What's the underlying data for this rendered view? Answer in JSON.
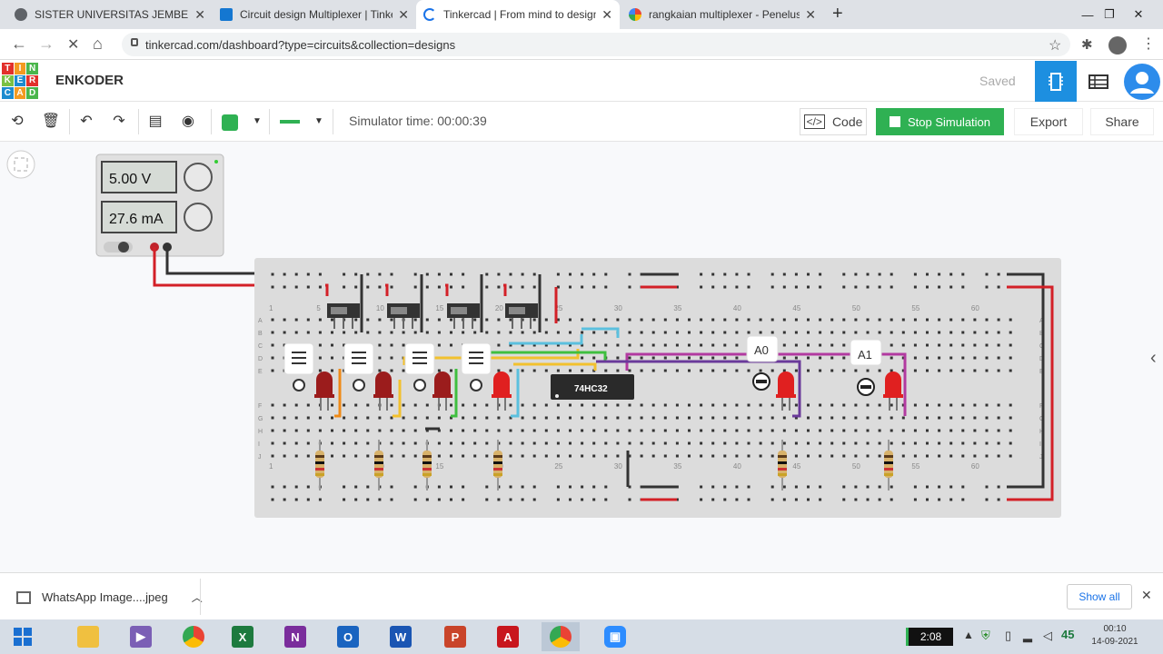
{
  "browser": {
    "tabs": [
      {
        "title": "SISTER UNIVERSITAS JEMBER",
        "active": false,
        "favicon": "globe-icon"
      },
      {
        "title": "Circuit design Multiplexer | Tinke",
        "active": false,
        "favicon": "tinkercad-icon"
      },
      {
        "title": "Tinkercad | From mind to design",
        "active": true,
        "favicon": "loading-icon"
      },
      {
        "title": "rangkaian multiplexer - Penelusu",
        "active": false,
        "favicon": "google-icon"
      }
    ],
    "url": "tinkercad.com/dashboard?type=circuits&collection=designs"
  },
  "app": {
    "logo_letters": [
      "T",
      "I",
      "N",
      "K",
      "E",
      "R",
      "C",
      "A",
      "D"
    ],
    "project_name": "ENKODER",
    "save_status": "Saved"
  },
  "toolbar": {
    "simulator_time": "Simulator time: 00:00:39",
    "code_label": "Code",
    "stop_label": "Stop Simulation",
    "export_label": "Export",
    "share_label": "Share",
    "color_swatch": "#2fb153"
  },
  "power_supply": {
    "voltage": "5.00 V",
    "current": "27.6 mA"
  },
  "circuit": {
    "ic_label": "74HC32",
    "probe_labels": [
      "A0",
      "A1"
    ],
    "column_numbers": [
      "1",
      "5",
      "10",
      "15",
      "20",
      "25",
      "30",
      "35",
      "40",
      "45",
      "50",
      "55",
      "60"
    ],
    "row_letters": [
      "A",
      "B",
      "C",
      "D",
      "E",
      "F",
      "G",
      "H",
      "I",
      "J"
    ]
  },
  "download_bar": {
    "file_name": "WhatsApp Image....jpeg",
    "show_all": "Show all"
  },
  "taskbar": {
    "badge_time": "2:08",
    "tray_number": "45",
    "clock_time": "00:10",
    "clock_date": "14-09-2021"
  }
}
